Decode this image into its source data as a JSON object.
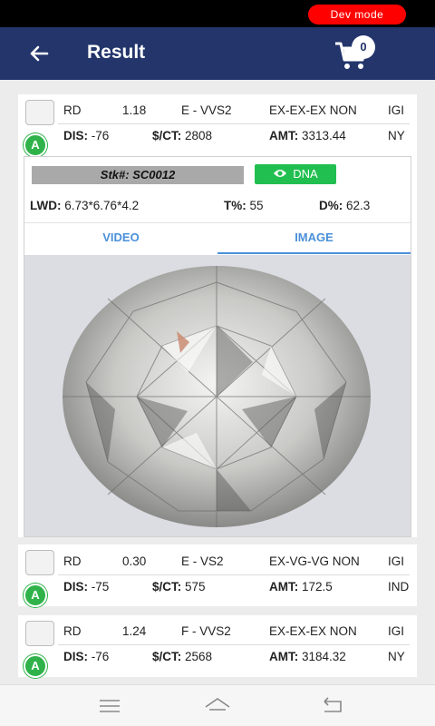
{
  "status": {
    "dev_badge": "Dev mode"
  },
  "header": {
    "title": "Result",
    "cart_count": "0"
  },
  "labels": {
    "dis": "DIS:",
    "per_ct": "$/CT:",
    "amt": "AMT:",
    "lwd": "LWD:",
    "table": "T%:",
    "depth": "D%:"
  },
  "items": [
    {
      "shape": "RD",
      "carat": "1.18",
      "color_clarity": "E - VVS2",
      "cut": "EX-EX-EX NON",
      "lab": "IGI",
      "lab_badge": "A",
      "dis": "-76",
      "per_ct": "2808",
      "amt": "3313.44",
      "location": "NY",
      "stock": "Stk#: SC0012",
      "dna_label": "DNA",
      "lwd": "6.73*6.76*4.2",
      "table": "55",
      "depth": "62.3",
      "tabs": [
        "VIDEO",
        "IMAGE"
      ],
      "active_tab": "IMAGE"
    },
    {
      "shape": "RD",
      "carat": "0.30",
      "color_clarity": "E - VS2",
      "cut": "EX-VG-VG NON",
      "lab": "IGI",
      "lab_badge": "A",
      "dis": "-75",
      "per_ct": "575",
      "amt": "172.5",
      "location": "IND"
    },
    {
      "shape": "RD",
      "carat": "1.24",
      "color_clarity": "F - VVS2",
      "cut": "EX-EX-EX NON",
      "lab": "IGI",
      "lab_badge": "A",
      "dis": "-76",
      "per_ct": "2568",
      "amt": "3184.32",
      "location": "NY"
    }
  ],
  "colors": {
    "appbar": "#23356b",
    "dna": "#21bf4f",
    "lab_badge": "#2fb24a",
    "tab_accent": "#4a90d9",
    "dev_badge": "#ff0000"
  },
  "icons": {
    "back": "arrow-left-icon",
    "cart": "cart-icon",
    "dna": "eye-icon",
    "nav": [
      "menu-icon",
      "home-icon",
      "back-icon"
    ]
  }
}
